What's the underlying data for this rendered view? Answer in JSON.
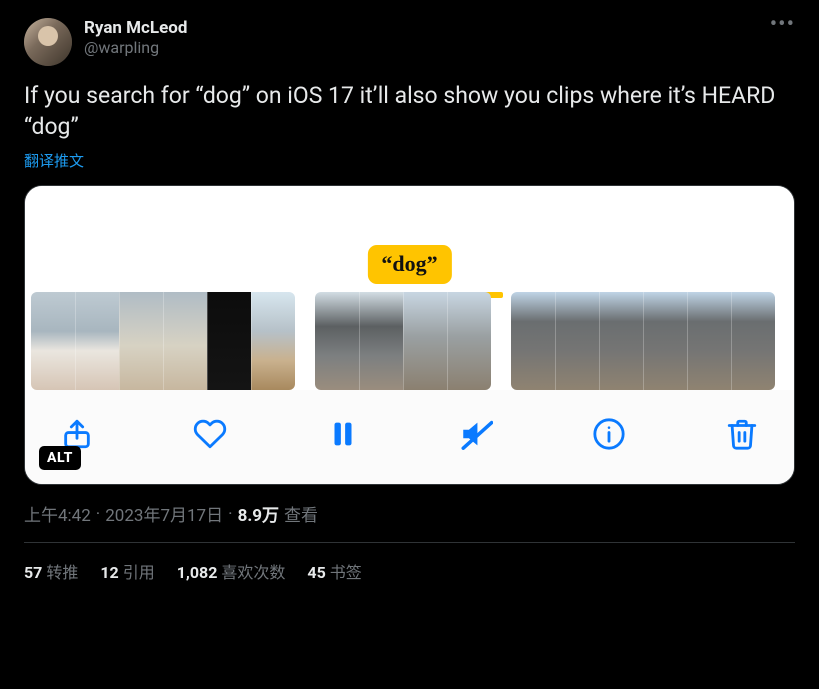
{
  "author": {
    "display_name": "Ryan McLeod",
    "handle": "@warpling"
  },
  "tweet": {
    "text": "If you search for “dog” on iOS 17 it’ll also show you clips where it’s HEARD “dog”",
    "translate_label": "翻译推文"
  },
  "media": {
    "search_chip": "“dog”",
    "alt_badge": "ALT",
    "toolbar": {
      "share": "share",
      "like": "like",
      "pause": "pause",
      "mute": "mute",
      "info": "info",
      "trash": "trash"
    }
  },
  "meta": {
    "time": "上午4:42",
    "date": "2023年7月17日",
    "views_value": "8.9万",
    "views_label": "查看"
  },
  "stats": {
    "retweets_value": "57",
    "retweets_label": "转推",
    "quotes_value": "12",
    "quotes_label": "引用",
    "likes_value": "1,082",
    "likes_label": "喜欢次数",
    "bookmarks_value": "45",
    "bookmarks_label": "书签"
  }
}
